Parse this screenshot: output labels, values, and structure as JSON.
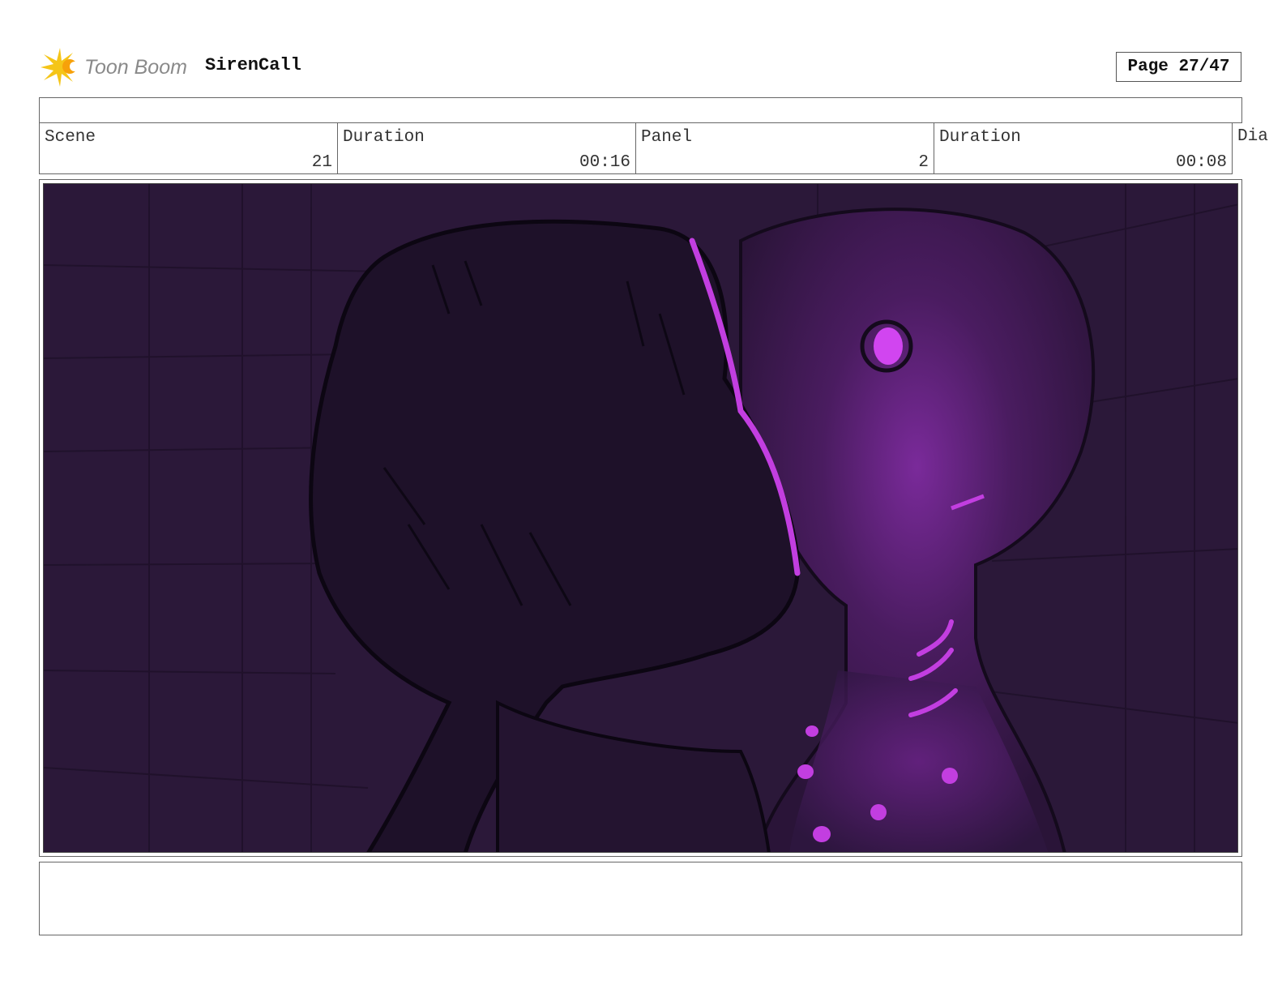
{
  "header": {
    "logo_text": "Toon Boom",
    "project_title": "SirenCall",
    "page_label": "Page 27/47"
  },
  "info": {
    "scene_label": "Scene",
    "scene_value": "21",
    "scene_duration_label": "Duration",
    "scene_duration_value": "00:16",
    "panel_label": "Panel",
    "panel_value": "2",
    "panel_duration_label": "Duration",
    "panel_duration_value": "00:08",
    "dialogue_label": "Dia"
  },
  "colors": {
    "frame_background": "#2a1838",
    "glow": "#c23ee0",
    "logo_star": "#f5c518",
    "logo_text": "#8a8a8a"
  },
  "notes": {
    "text": ""
  }
}
